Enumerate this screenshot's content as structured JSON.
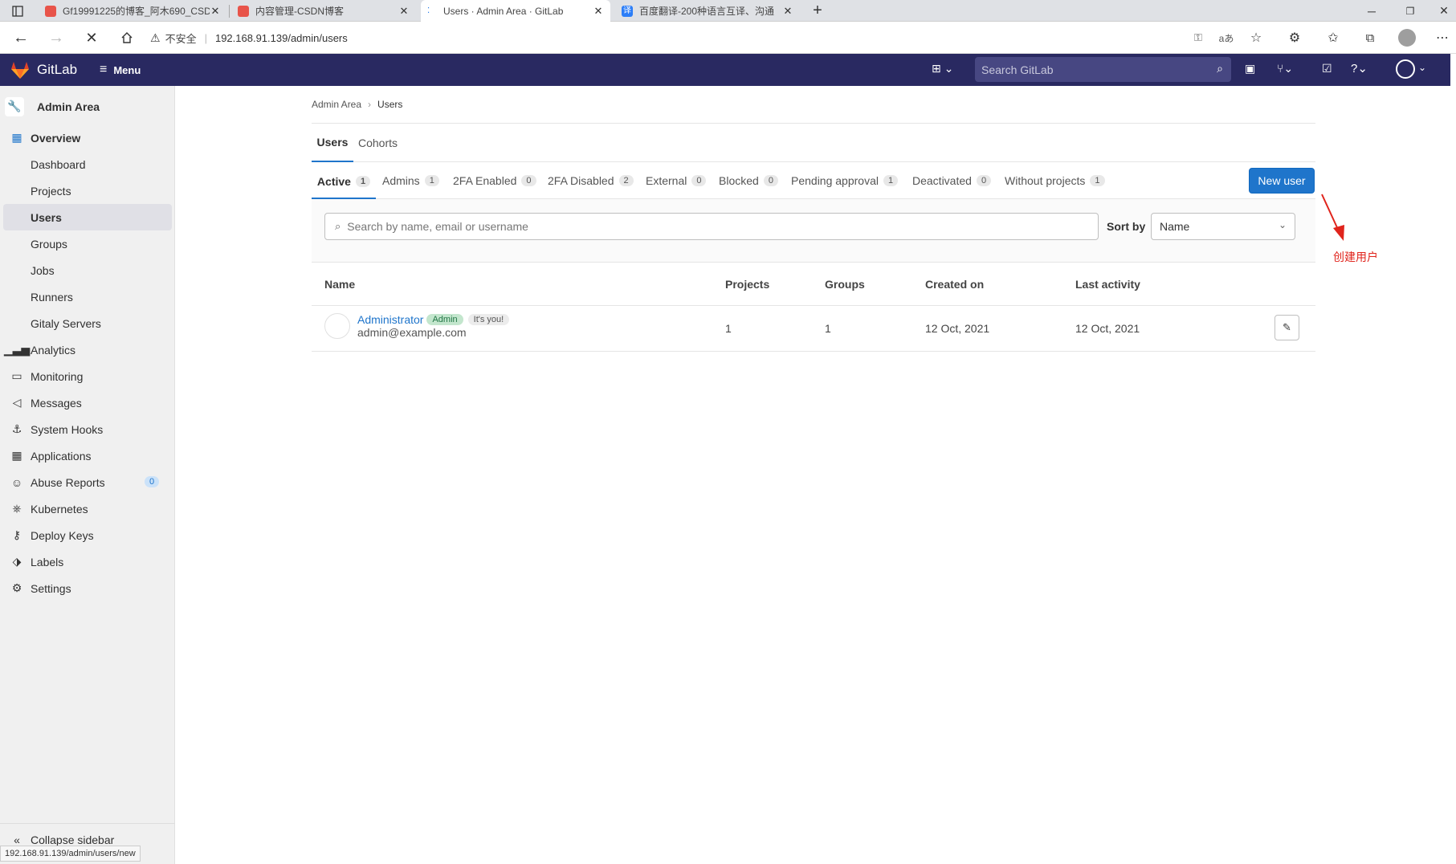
{
  "browser": {
    "tabs": [
      {
        "title": "Gf19991225的博客_阿木690_CSD",
        "icon_color": "#e8544a"
      },
      {
        "title": "内容管理-CSDN博客",
        "icon_color": "#e8544a"
      },
      {
        "title": "Users · Admin Area · GitLab",
        "icon_color": "#292961"
      },
      {
        "title": "百度翻译-200种语言互译、沟通",
        "icon_color": "#2c7ef8"
      }
    ],
    "security_label": "不安全",
    "url": "192.168.91.139/admin/users",
    "status_url": "192.168.91.139/admin/users/new"
  },
  "header": {
    "brand": "GitLab",
    "menu_label": "Menu",
    "search_placeholder": "Search GitLab"
  },
  "sidebar": {
    "title": "Admin Area",
    "overview": "Overview",
    "sub_items": [
      "Dashboard",
      "Projects",
      "Users",
      "Groups",
      "Jobs",
      "Runners",
      "Gitaly Servers"
    ],
    "items": [
      {
        "label": "Analytics",
        "icon": "analytics-icon"
      },
      {
        "label": "Monitoring",
        "icon": "monitor-icon"
      },
      {
        "label": "Messages",
        "icon": "megaphone-icon"
      },
      {
        "label": "System Hooks",
        "icon": "hook-icon"
      },
      {
        "label": "Applications",
        "icon": "applications-icon"
      },
      {
        "label": "Abuse Reports",
        "icon": "abuse-icon",
        "count": "0"
      },
      {
        "label": "Kubernetes",
        "icon": "kubernetes-icon"
      },
      {
        "label": "Deploy Keys",
        "icon": "key-icon"
      },
      {
        "label": "Labels",
        "icon": "label-icon"
      },
      {
        "label": "Settings",
        "icon": "settings-icon"
      }
    ],
    "collapse_label": "Collapse sidebar"
  },
  "breadcrumb": {
    "parent": "Admin Area",
    "current": "Users"
  },
  "top_tabs": [
    "Users",
    "Cohorts"
  ],
  "filters": [
    {
      "label": "Active",
      "count": "1"
    },
    {
      "label": "Admins",
      "count": "1"
    },
    {
      "label": "2FA Enabled",
      "count": "0"
    },
    {
      "label": "2FA Disabled",
      "count": "2"
    },
    {
      "label": "External",
      "count": "0"
    },
    {
      "label": "Blocked",
      "count": "0"
    },
    {
      "label": "Pending approval",
      "count": "1"
    },
    {
      "label": "Deactivated",
      "count": "0"
    },
    {
      "label": "Without projects",
      "count": "1"
    }
  ],
  "new_user_label": "New user",
  "annotation": "创建用户",
  "search": {
    "placeholder": "Search by name, email or username",
    "sort_label": "Sort by",
    "sort_value": "Name"
  },
  "table": {
    "headers": [
      "Name",
      "Projects",
      "Groups",
      "Created on",
      "Last activity"
    ],
    "rows": [
      {
        "name": "Administrator",
        "badge_admin": "Admin",
        "badge_you": "It's you!",
        "email": "admin@example.com",
        "projects": "1",
        "groups": "1",
        "created": "12 Oct, 2021",
        "last_activity": "12 Oct, 2021"
      }
    ]
  },
  "colors": {
    "header": "#292961",
    "primary": "#1f75cb",
    "annotation": "#e0241c"
  }
}
